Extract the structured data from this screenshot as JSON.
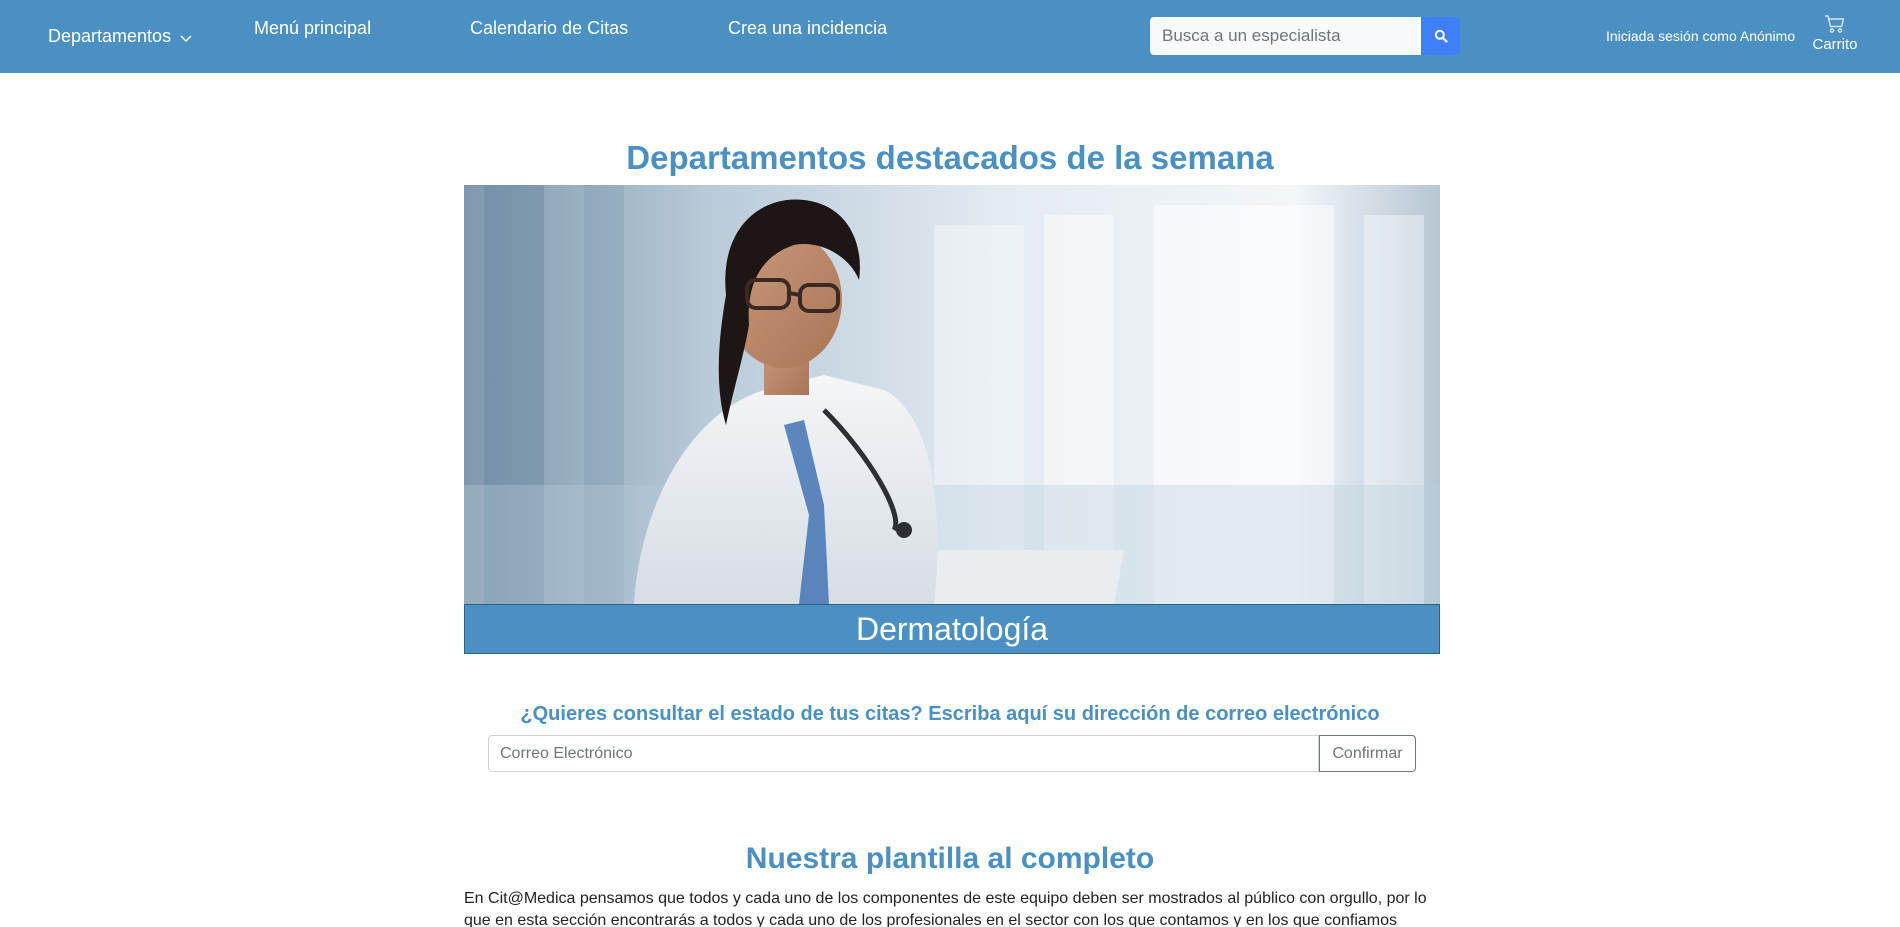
{
  "nav": {
    "departments_label": "Departamentos",
    "main_menu_label": "Menú principal",
    "calendar_label": "Calendario de Citas",
    "incident_label": "Crea una incidencia",
    "search_placeholder": "Busca a un especialista",
    "session_text": "Iniciada sesión como Anónimo",
    "cart_label": "Carrito"
  },
  "featured": {
    "title": "Departamentos destacados de la semana",
    "caption": "Dermatología"
  },
  "appointments": {
    "question": "¿Quieres consultar el estado de tus citas? Escriba aquí su dirección de correo electrónico",
    "email_placeholder": "Correo Electrónico",
    "confirm_label": "Confirmar"
  },
  "staff": {
    "title": "Nuestra plantilla al completo",
    "intro": "En Cit@Medica pensamos que todos y cada uno de los componentes de este equipo deben ser mostrados al público con orgullo, por lo que en esta sección encontrarás a todos y cada uno de los profesionales en el sector con los que contamos y en los que confiamos"
  },
  "colors": {
    "brand": "#4a90c2",
    "search_button": "#3d7fff"
  },
  "icons": {
    "departments_dropdown": "chevron-down-icon",
    "search": "search-icon",
    "cart": "cart-icon"
  }
}
